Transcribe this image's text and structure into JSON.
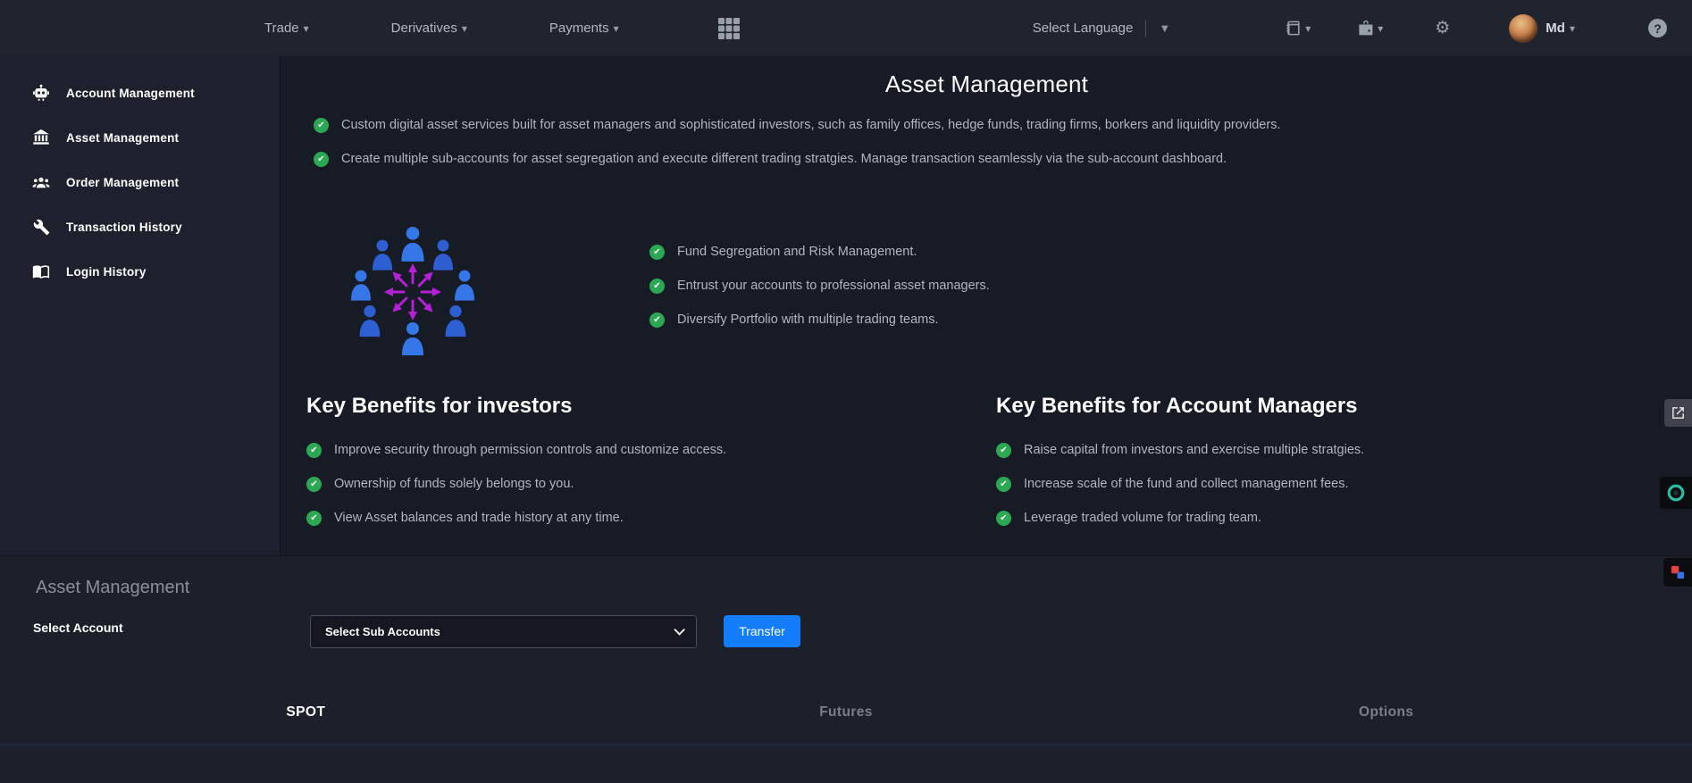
{
  "colors": {
    "accent_blue": "#147dfc",
    "check_green": "#2aa952",
    "illustration_blue_dark": "#2d5fd3",
    "illustration_blue_light": "#3577e8",
    "arrow_magenta": "#b51fd6",
    "chat_teal": "#27bfa5",
    "nav_bg": "#20242f",
    "sidebar_bg": "#1d212d",
    "content_bg": "#161b26",
    "panel_bg": "#1b202b"
  },
  "nav": {
    "menus": [
      {
        "label": "Trade",
        "icon": "caret-down-icon"
      },
      {
        "label": "Derivatives",
        "icon": "caret-down-icon"
      },
      {
        "label": "Payments",
        "icon": "caret-down-icon"
      }
    ],
    "apps_icon": "apps-grid-icon",
    "language_label": "Select Language",
    "language_icon": "triangle-down-icon",
    "right_icons": [
      "orders-book-icon",
      "wallet-lock-icon",
      "settings-gear-icon"
    ],
    "user_label": "Md",
    "help_icon": "help-question-icon"
  },
  "sidebar": {
    "items": [
      {
        "icon": "robot-icon",
        "label": "Account Management"
      },
      {
        "icon": "bank-icon",
        "label": "Asset Management"
      },
      {
        "icon": "users-icon",
        "label": "Order Management"
      },
      {
        "icon": "wrench-icon",
        "label": "Transaction History"
      },
      {
        "icon": "open-book-icon",
        "label": "Login History"
      }
    ]
  },
  "main": {
    "title": "Asset Management",
    "intro": [
      "Custom digital asset services built for asset managers and sophisticated investors, such as family offices, hedge funds, trading firms, borkers and liquidity providers.",
      "Create multiple sub-accounts for asset segregation and execute different trading stratgies. Manage transaction seamlessly via the sub-account dashboard."
    ],
    "illustration": "team-network-illustration",
    "features": [
      "Fund Segregation and Risk Management.",
      "Entrust your accounts to professional asset managers.",
      "Diversify Portfolio with multiple trading teams."
    ],
    "benefits_investors": {
      "title": "Key Benefits for investors",
      "items": [
        "Improve security through permission controls and customize access.",
        "Ownership of funds solely belongs to you.",
        "View Asset balances and trade history at any time."
      ]
    },
    "benefits_managers": {
      "title": "Key Benefits for Account Managers",
      "items": [
        "Raise capital from investors and exercise multiple stratgies.",
        "Increase scale of the fund and collect management fees.",
        "Leverage traded volume for trading team."
      ]
    }
  },
  "panel": {
    "title": "Asset Management",
    "select_label": "Select Account",
    "select_placeholder": "Select Sub Accounts",
    "transfer_label": "Transfer",
    "tabs": [
      {
        "label": "SPOT",
        "active": true
      },
      {
        "label": "Futures",
        "active": false
      },
      {
        "label": "Options",
        "active": false
      }
    ]
  },
  "float_buttons": [
    "share-icon",
    "chat-widget-icon",
    "extension-icon"
  ]
}
